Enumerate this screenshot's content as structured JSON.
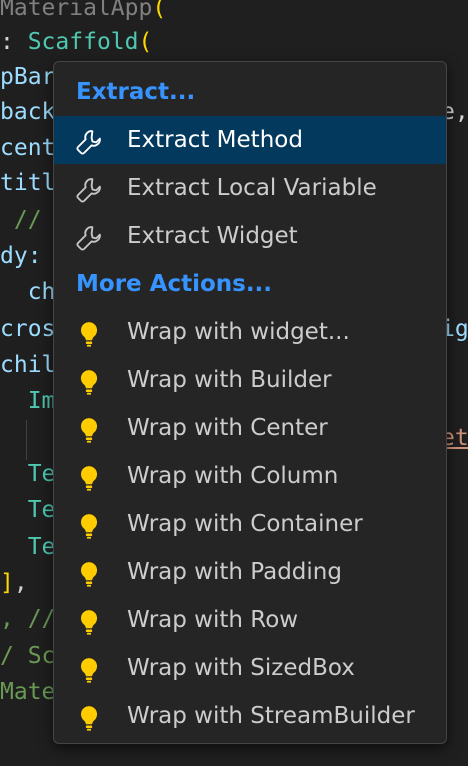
{
  "code": {
    "lines": [
      {
        "parts": [
          {
            "t": "MaterialApp",
            "c": "c-type c-dim"
          },
          {
            "t": "(",
            "c": "c-paren"
          }
        ]
      },
      {
        "parts": [
          {
            "t": ": ",
            "c": "c-punct"
          },
          {
            "t": "Scaffold",
            "c": "c-type"
          },
          {
            "t": "(",
            "c": "c-paren"
          }
        ]
      },
      {
        "parts": [
          {
            "t": "pBar",
            "c": "c-prop"
          }
        ]
      },
      {
        "parts": [
          {
            "t": "back",
            "c": "c-prop"
          }
        ]
      },
      {
        "parts": [
          {
            "t": "cent",
            "c": "c-prop"
          }
        ]
      },
      {
        "parts": [
          {
            "t": "titl",
            "c": "c-prop"
          }
        ]
      },
      {
        "parts": [
          {
            "t": " // ",
            "c": "c-comment"
          }
        ]
      },
      {
        "parts": [
          {
            "t": "dy:",
            "c": "c-prop"
          }
        ]
      },
      {
        "parts": [
          {
            "t": "  ch",
            "c": "c-prop"
          }
        ]
      },
      {
        "parts": [
          {
            "t": "cros",
            "c": "c-prop"
          }
        ]
      },
      {
        "parts": [
          {
            "t": "chil",
            "c": "c-prop"
          }
        ]
      },
      {
        "parts": [
          {
            "t": "  Im",
            "c": "c-type"
          }
        ]
      },
      {
        "parts": [
          {
            "t": "",
            "c": "c-punct"
          }
        ]
      },
      {
        "parts": [
          {
            "t": "  Te",
            "c": "c-type"
          }
        ]
      },
      {
        "parts": [
          {
            "t": "  Te",
            "c": "c-type"
          }
        ]
      },
      {
        "parts": [
          {
            "t": "  Te",
            "c": "c-type"
          }
        ]
      },
      {
        "parts": [
          {
            "t": "]",
            "c": "c-paren"
          },
          {
            "t": ",",
            "c": "c-punct"
          }
        ]
      },
      {
        "parts": [
          {
            "t": ", //",
            "c": "c-comment"
          }
        ]
      },
      {
        "parts": [
          {
            "t": "/ Sc",
            "c": "c-comment"
          }
        ]
      },
      {
        "parts": [
          {
            "t": "Mate",
            "c": "c-comment"
          }
        ]
      }
    ],
    "right_fragments": [
      {
        "t": "e,",
        "c": "c-punct"
      },
      {
        "t": "ig",
        "c": "c-prop"
      },
      {
        "t": "et",
        "c": "c-err"
      }
    ]
  },
  "menu": {
    "sections": [
      {
        "header": "Extract...",
        "items": [
          {
            "label": "Extract Method",
            "icon": "wrench-icon",
            "selected": true
          },
          {
            "label": "Extract Local Variable",
            "icon": "wrench-icon",
            "selected": false
          },
          {
            "label": "Extract Widget",
            "icon": "wrench-icon",
            "selected": false
          }
        ]
      },
      {
        "header": "More Actions...",
        "items": [
          {
            "label": "Wrap with widget...",
            "icon": "lightbulb-icon",
            "selected": false
          },
          {
            "label": "Wrap with Builder",
            "icon": "lightbulb-icon",
            "selected": false
          },
          {
            "label": "Wrap with Center",
            "icon": "lightbulb-icon",
            "selected": false
          },
          {
            "label": "Wrap with Column",
            "icon": "lightbulb-icon",
            "selected": false
          },
          {
            "label": "Wrap with Container",
            "icon": "lightbulb-icon",
            "selected": false
          },
          {
            "label": "Wrap with Padding",
            "icon": "lightbulb-icon",
            "selected": false
          },
          {
            "label": "Wrap with Row",
            "icon": "lightbulb-icon",
            "selected": false
          },
          {
            "label": "Wrap with SizedBox",
            "icon": "lightbulb-icon",
            "selected": false
          },
          {
            "label": "Wrap with StreamBuilder",
            "icon": "lightbulb-icon",
            "selected": false
          }
        ]
      }
    ]
  },
  "colors": {
    "header": "#3794ff",
    "selected_bg": "#04395e",
    "bulb": "#ffcc00",
    "wrench": "#c5c5c5"
  }
}
